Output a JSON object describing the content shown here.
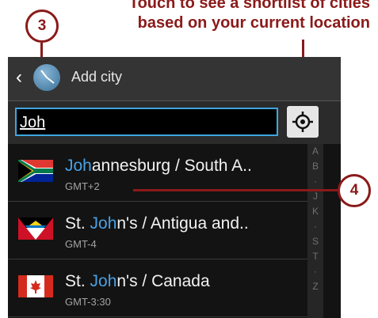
{
  "callout": {
    "line1": "Touch to see a shortlist of cities",
    "line2": "based on your current location",
    "badge3": "3",
    "badge4": "4"
  },
  "action_bar": {
    "back_icon": "chevron-left-icon",
    "app_icon": "world-clock-icon",
    "title": "Add city"
  },
  "search": {
    "value": "Joh",
    "location_icon": "crosshair-icon"
  },
  "cities": [
    {
      "highlight": "Joh",
      "rest": "annesburg / South A..",
      "gmt": "GMT+2",
      "flag": "south-africa-flag"
    },
    {
      "prefix": "St. ",
      "highlight": "Joh",
      "rest": "n's / Antigua and..",
      "gmt": "GMT-4",
      "flag": "antigua-flag"
    },
    {
      "prefix": "St. ",
      "highlight": "Joh",
      "rest": "n's / Canada",
      "gmt": "GMT-3:30",
      "flag": "canada-flag"
    }
  ],
  "index_letters": [
    "A",
    "B",
    "·",
    "J",
    "K",
    "·",
    "S",
    "T",
    "·",
    "Z"
  ],
  "colors": {
    "accent": "#8b1a1a",
    "highlight": "#4aa0e2",
    "focus": "#3fa6e0"
  }
}
